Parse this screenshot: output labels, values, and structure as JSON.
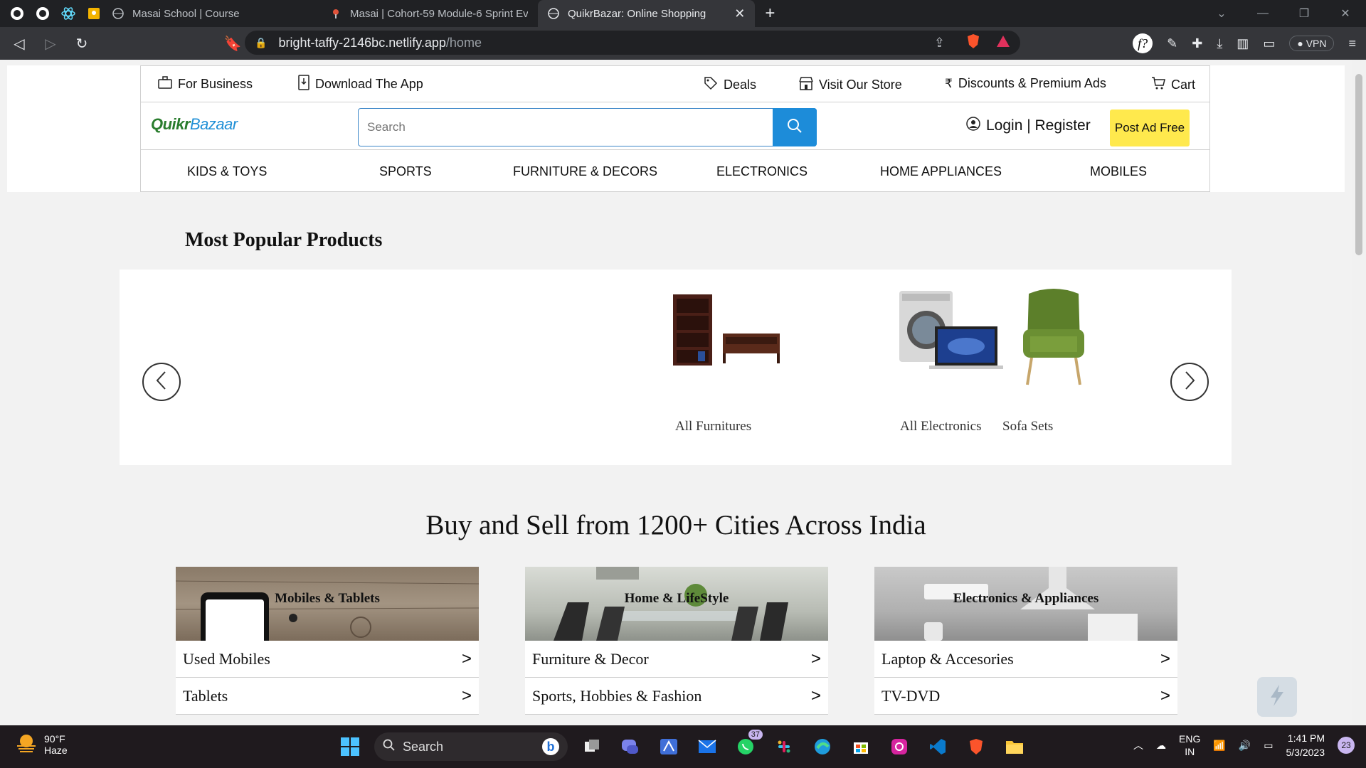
{
  "browser": {
    "tabs": [
      {
        "title": "Masai School | Course",
        "active": false
      },
      {
        "title": "Masai | Cohort-59 Module-6 Sprint Ev",
        "active": false
      },
      {
        "title": "QuikrBazar: Online Shopping",
        "active": true
      }
    ],
    "url_host": "bright-taffy-2146bc.netlify.app",
    "url_path": "/home",
    "vpn_label": "VPN"
  },
  "topbar": {
    "for_business": "For Business",
    "download_app": "Download The App",
    "deals": "Deals",
    "visit_store": "Visit Our Store",
    "discounts": "Discounts & Premium Ads",
    "cart": "Cart"
  },
  "header": {
    "logo_part1": "Quikr",
    "logo_part2": "Bazaar",
    "search_placeholder": "Search",
    "login_register": "Login | Register",
    "post_ad": "Post Ad Free"
  },
  "categories": [
    "KIDS & TOYS",
    "SPORTS",
    "FURNITURE & DECORS",
    "ELECTRONICS",
    "HOME APPLIANCES",
    "MOBILES"
  ],
  "popular": {
    "title": "Most Popular Products",
    "items": [
      "All Furnitures",
      "All Electronics",
      "Sofa Sets"
    ]
  },
  "cities": {
    "title": "Buy and Sell from 1200+ Cities Across India",
    "cards": [
      {
        "title": "Mobiles & Tablets",
        "rows": [
          "Used Mobiles",
          "Tablets"
        ]
      },
      {
        "title": "Home & LifeStyle",
        "rows": [
          "Furniture & Decor",
          "Sports, Hobbies & Fashion"
        ]
      },
      {
        "title": "Electronics & Appliances",
        "rows": [
          "Laptop & Accesories",
          "TV-DVD"
        ]
      }
    ],
    "row_arrow": ">"
  },
  "taskbar": {
    "temperature": "90°F",
    "condition": "Haze",
    "search_label": "Search",
    "whatsapp_badge": "37",
    "lang_top": "ENG",
    "lang_bottom": "IN",
    "time": "1:41 PM",
    "date": "5/3/2023",
    "notifications": "23"
  },
  "colors": {
    "accent_blue": "#1d8cd9",
    "post_ad_yellow": "#ffe94d",
    "logo_green": "#2a7d2e"
  }
}
